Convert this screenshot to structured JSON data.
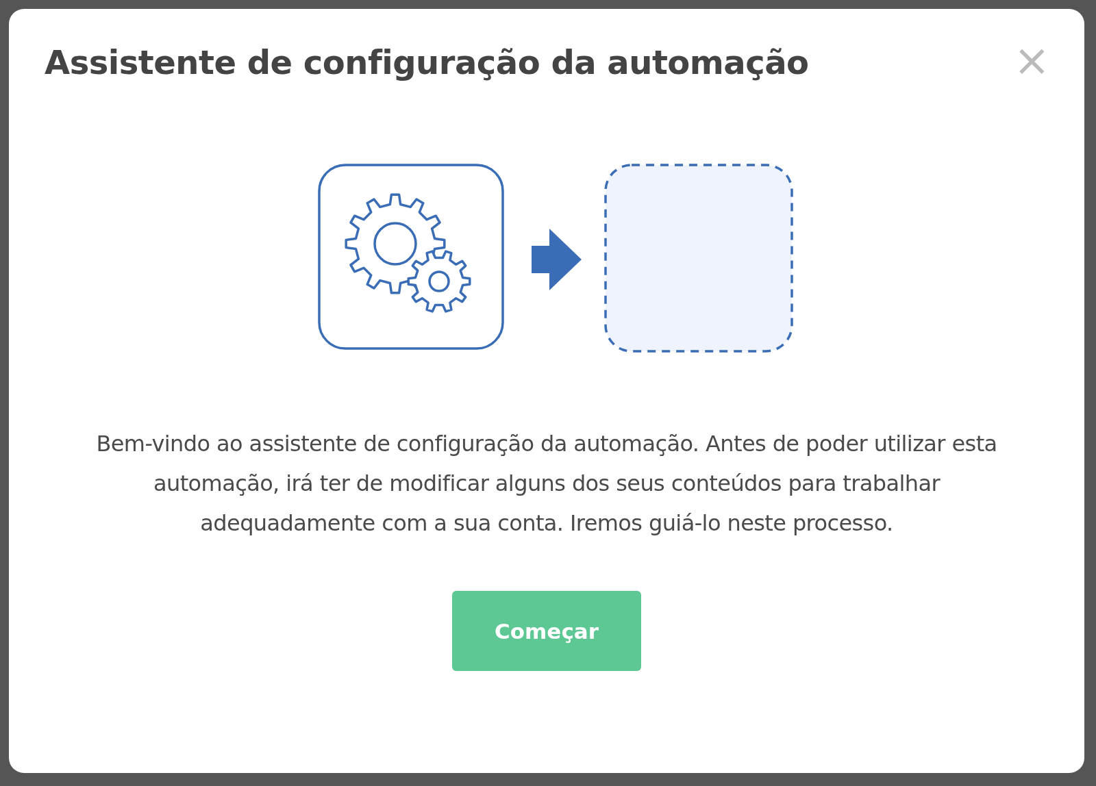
{
  "dialog": {
    "title": "Assistente de configuração da automação",
    "close_label": "×",
    "message": "Bem-vindo ao assistente de configuração da automação. Antes de poder utilizar esta automação, irá ter de modificar alguns dos seus conteúdos para trabalhar adequadamente com a sua conta. Iremos guiá-lo neste processo.",
    "start_button": "Começar"
  }
}
